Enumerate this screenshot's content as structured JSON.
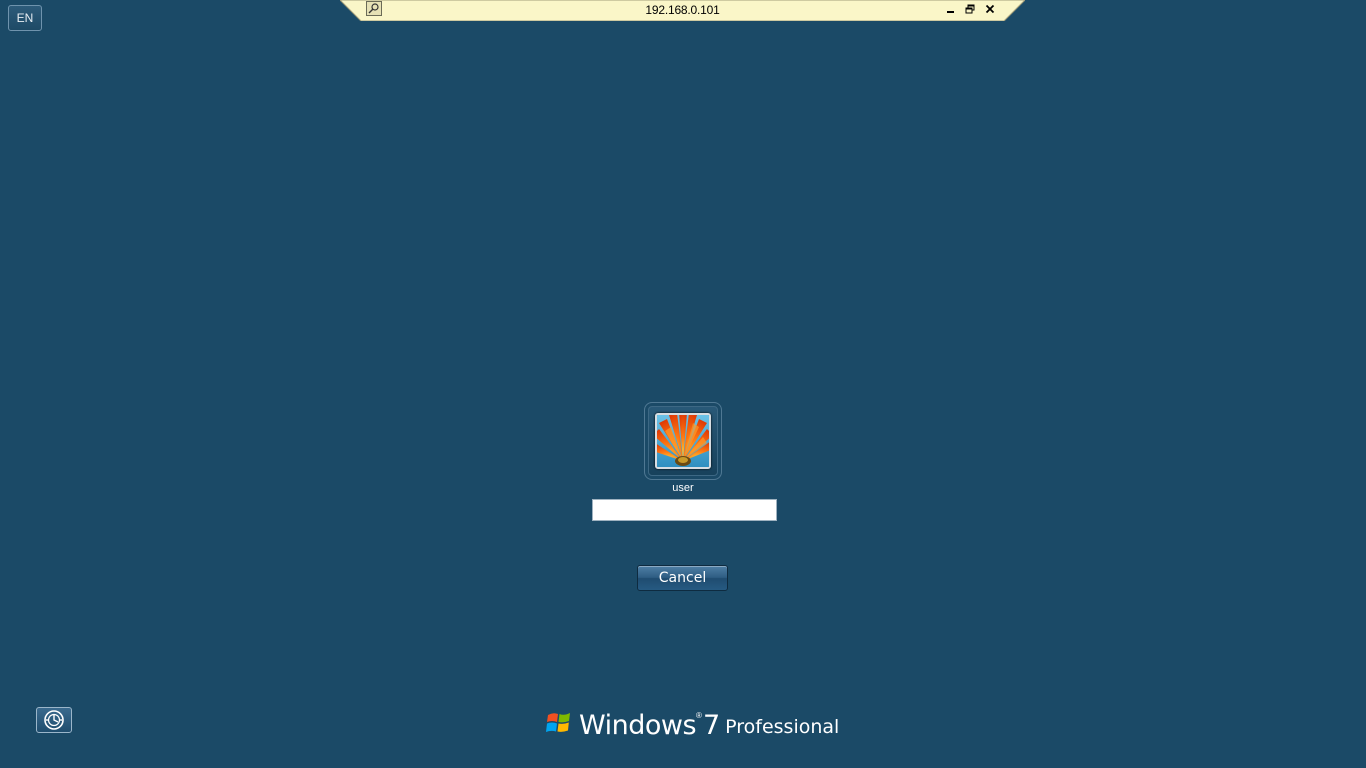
{
  "connection_bar": {
    "title": "192.168.0.101",
    "pin_icon": "pin-icon",
    "minimize_icon": "minimize-icon",
    "restore_icon": "restore-icon",
    "close_icon": "close-icon",
    "background_color": "#faf6c8"
  },
  "language": {
    "label": "EN"
  },
  "login": {
    "username": "user",
    "password_value": "",
    "password_placeholder": "",
    "cancel_label": "Cancel",
    "avatar_icon": "flower-avatar"
  },
  "ease_of_access": {
    "icon": "ease-of-access-icon"
  },
  "branding": {
    "product": "Windows",
    "trademark": "®",
    "version": "7",
    "edition": "Professional",
    "logo_icon": "windows-flag-icon"
  },
  "colors": {
    "background": "#1b4a67",
    "text": "#ffffff"
  }
}
